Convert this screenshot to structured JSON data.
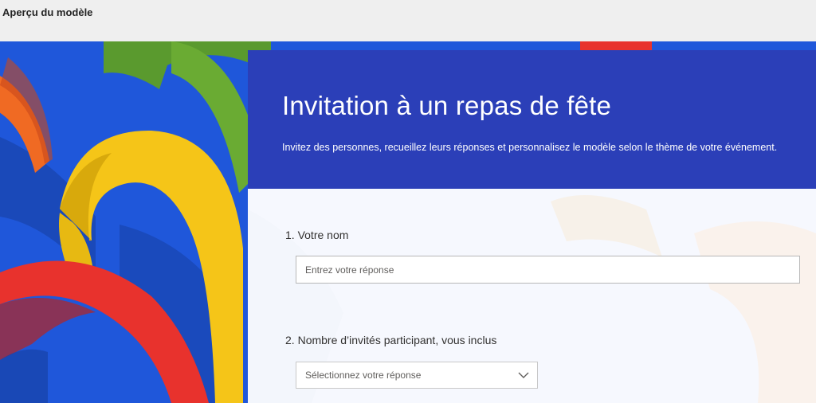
{
  "window": {
    "title": "Aperçu du modèle"
  },
  "form": {
    "title": "Invitation à un repas de fête",
    "description": "Invitez des personnes, recueillez leurs réponses et personnalisez le modèle selon le thème de votre événement.",
    "questions": [
      {
        "number": "1.",
        "label": "Votre nom",
        "placeholder": "Entrez votre réponse"
      },
      {
        "number": "2.",
        "label": "Nombre d’invités participant, vous inclus",
        "selected_value": "Sélectionnez votre réponse"
      }
    ]
  },
  "colors": {
    "header": "#2b3fb8",
    "background_blue": "#1f55d6",
    "arch_red": "#e8322d",
    "arch_yellow": "#f5c518",
    "arch_green": "#5a9a2e",
    "arch_orange": "#f06a23"
  },
  "icons": {
    "dropdown": "chevron-down-icon"
  }
}
